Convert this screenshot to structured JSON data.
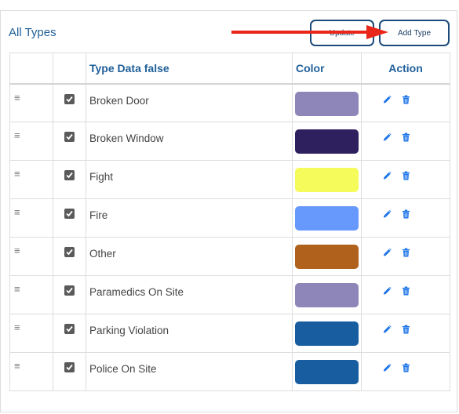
{
  "header": {
    "title": "All Types",
    "update_label": "Update",
    "add_label": "Add Type"
  },
  "table": {
    "columns": [
      "",
      "",
      "Type Data false",
      "Color",
      "Action"
    ],
    "rows": [
      {
        "name": "Broken Door",
        "color": "#8e86b8",
        "checked": true
      },
      {
        "name": "Broken Window",
        "color": "#2e1f5e",
        "checked": true
      },
      {
        "name": "Fight",
        "color": "#f4fb5a",
        "checked": true
      },
      {
        "name": "Fire",
        "color": "#6699fb",
        "checked": true
      },
      {
        "name": "Other",
        "color": "#b0611b",
        "checked": true
      },
      {
        "name": "Paramedics On Site",
        "color": "#8e86b8",
        "checked": true
      },
      {
        "name": "Parking Violation",
        "color": "#175da0",
        "checked": true
      },
      {
        "name": "Police On Site",
        "color": "#175da0",
        "checked": true
      }
    ]
  },
  "icons": {
    "drag": "drag-handle-icon",
    "check": "checkbox-checked-icon",
    "edit": "pencil-icon",
    "delete": "trash-icon"
  },
  "colors": {
    "accent": "#1f5f99",
    "action_icon": "#1a73e8",
    "arrow": "#e8261a"
  }
}
